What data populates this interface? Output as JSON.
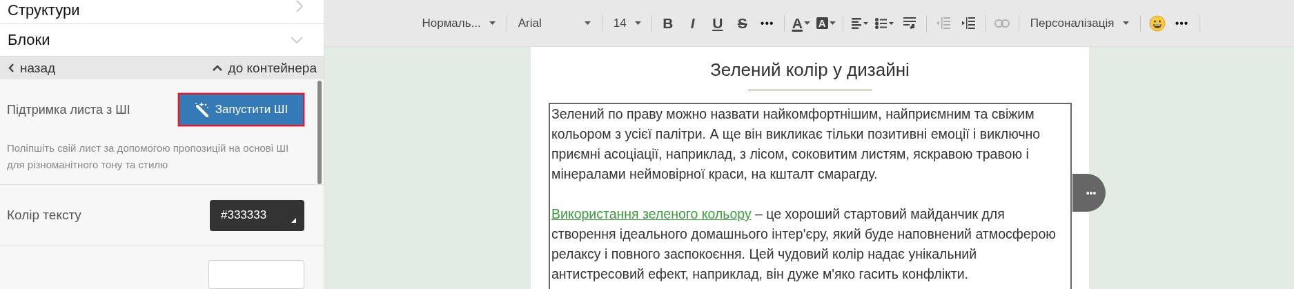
{
  "sidebar": {
    "sections": [
      {
        "label": "Структури",
        "expanded": false
      },
      {
        "label": "Блоки",
        "expanded": true
      }
    ],
    "nav": {
      "back": "назад",
      "up": "до контейнера"
    },
    "ai": {
      "label": "Підтримка листа з ШІ",
      "button": "Запустити ШІ",
      "description": "Поліпшіть свій лист за допомогою пропозицій на основі ШІ для різноманітного тону та стилю"
    },
    "text_color": {
      "label": "Колір тексту",
      "value": "#333333"
    }
  },
  "toolbar": {
    "items": [
      {
        "kind": "select",
        "label": "Нормаль..."
      },
      {
        "kind": "sep"
      },
      {
        "kind": "select",
        "label": "Arial"
      },
      {
        "kind": "sep"
      },
      {
        "kind": "select",
        "label": "14"
      },
      {
        "kind": "sep"
      },
      {
        "kind": "bold",
        "label": "B"
      },
      {
        "kind": "italic",
        "label": "I"
      },
      {
        "kind": "underline",
        "label": "U"
      },
      {
        "kind": "strike",
        "label": "S"
      },
      {
        "kind": "more",
        "label": "•••"
      },
      {
        "kind": "sep"
      },
      {
        "kind": "font-color",
        "label": "A"
      },
      {
        "kind": "highlight",
        "label": "A"
      },
      {
        "kind": "sep"
      },
      {
        "kind": "align",
        "disabled": false
      },
      {
        "kind": "list",
        "disabled": false
      },
      {
        "kind": "wrap",
        "disabled": false
      },
      {
        "kind": "sep"
      },
      {
        "kind": "outdent",
        "disabled": true
      },
      {
        "kind": "indent",
        "disabled": false
      },
      {
        "kind": "sep"
      },
      {
        "kind": "link",
        "disabled": true
      },
      {
        "kind": "sep"
      },
      {
        "kind": "select",
        "label": "Персоналізація"
      },
      {
        "kind": "sep"
      },
      {
        "kind": "emoji",
        "disabled": false
      },
      {
        "kind": "more",
        "label": "•••"
      },
      {
        "kind": "sep"
      }
    ]
  },
  "document": {
    "title": "Зелений колір у дизайні",
    "paragraphs": [
      {
        "text": "Зелений по праву можно назвати найкомфортнішим, найприємним та свіжим кольором з усієї палітри. А ще він викликає тільки позитивні емоції і виключно приємні асоціації, наприклад, з лісом, соковитим листям, яскравою травою і мінералами неймовірної краси, на кшталт смарагду."
      },
      {
        "link": "Використання зеленого кольору",
        "text": " – це хороший стартовий майданчик для створення ідеального домашнього інтер'єру, який буде наповнений атмосферою релаксу і повного заспокоєння. Цей чудовий колір надає унікальний антистресовий ефект, наприклад, він дуже м'яко гасить конфлікти."
      }
    ],
    "more_button": "•••"
  }
}
